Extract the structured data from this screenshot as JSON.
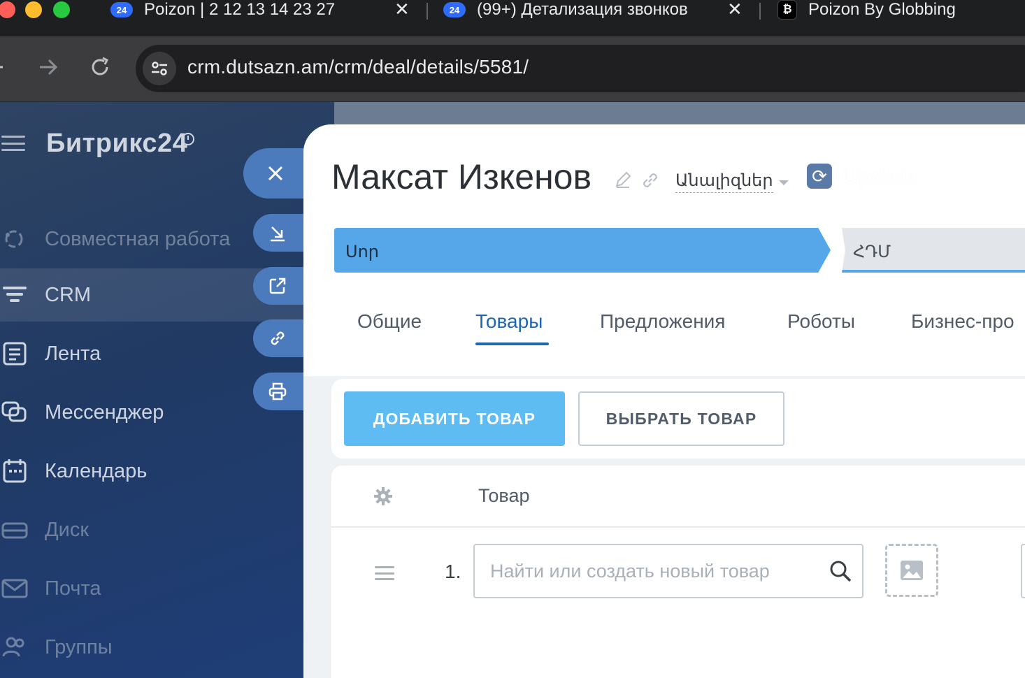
{
  "browser": {
    "tabs": [
      {
        "favicon": "24",
        "title": "Poizon | 2 12 13 14 23 27",
        "close": "✕"
      },
      {
        "favicon": "24",
        "title": "(99+) Детализация звонков",
        "close": "✕"
      },
      {
        "favicon": "₿",
        "title": "Poizon By Globbing"
      }
    ],
    "url": "crm.dutsazn.am/crm/deal/details/5581/"
  },
  "sidebar": {
    "logo": "Битрикс24",
    "items": [
      {
        "label": "Совместная работа",
        "icon": "collab-icon"
      },
      {
        "label": "CRM",
        "icon": "crm-filter-icon"
      },
      {
        "label": "Лента",
        "icon": "feed-icon"
      },
      {
        "label": "Мессенджер",
        "icon": "messenger-icon"
      },
      {
        "label": "Календарь",
        "icon": "calendar-icon"
      },
      {
        "label": "Диск",
        "icon": "disk-icon"
      },
      {
        "label": "Почта",
        "icon": "mail-icon"
      },
      {
        "label": "Группы",
        "icon": "groups-icon"
      }
    ]
  },
  "deal": {
    "title": "Максат Изкенов",
    "analyses": "Անալիզներ",
    "update_label": "Update",
    "stages": [
      {
        "label": "Սոր",
        "color": "#55a7ea"
      },
      {
        "label": "ՀԴՄ",
        "color": "#e2e6ea"
      }
    ],
    "tabs": [
      "Общие",
      "Товары",
      "Предложения",
      "Роботы",
      "Бизнес-про"
    ],
    "active_tab": "Товары"
  },
  "products": {
    "add_button": "ДОБАВИТЬ ТОВАР",
    "select_button": "ВЫБРАТЬ ТОВАР",
    "column_product": "Товар",
    "row_number": "1.",
    "search_placeholder": "Найти или создать новый товар"
  }
}
